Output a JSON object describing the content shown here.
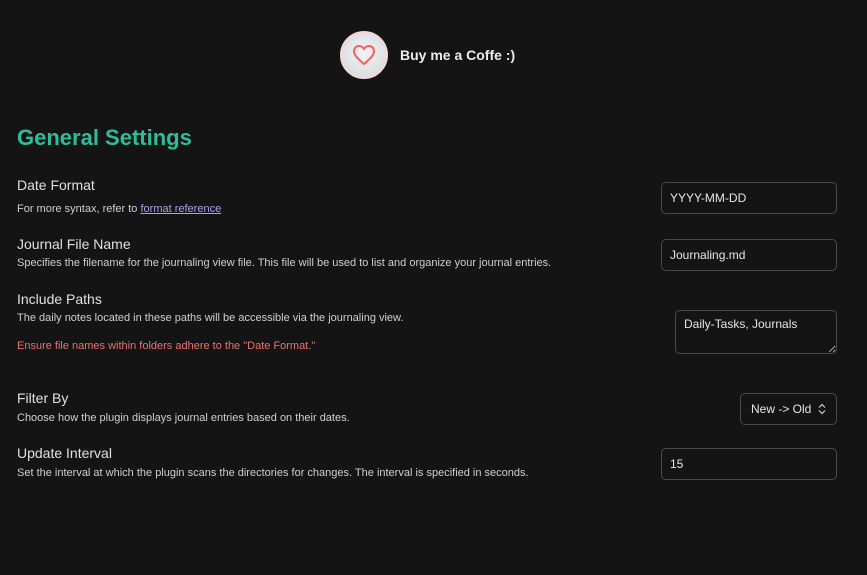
{
  "coffee": {
    "label": "Buy me a Coffe :)",
    "icon": "heart-icon"
  },
  "title": "General Settings",
  "settings": [
    {
      "name": "Date Format",
      "desc_prefix": "For more syntax, refer to ",
      "link": "format reference",
      "value": "YYYY-MM-DD"
    },
    {
      "name": "Journal File Name",
      "desc": "Specifies the filename for the journaling view file. This file will be used to list and organize your journal entries.",
      "value": "Journaling.md"
    },
    {
      "name": "Include Paths",
      "desc": "The daily notes located in these paths will be accessible via the journaling view.",
      "warning": "Ensure file names within folders adhere to the \"Date Format.\"",
      "value": "Daily-Tasks, Journals"
    },
    {
      "name": "Filter By",
      "desc": "Choose how the plugin displays journal entries based on their dates.",
      "value": "New -> Old"
    },
    {
      "name": "Update Interval",
      "desc": "Set the interval at which the plugin scans the directories for changes. The interval is specified in seconds.",
      "value": "15"
    }
  ]
}
